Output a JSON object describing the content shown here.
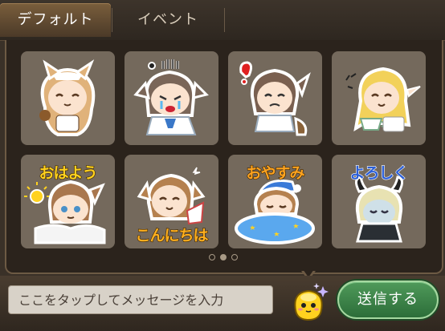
{
  "tabs": [
    {
      "label": "デフォルト",
      "active": true
    },
    {
      "label": "イベント",
      "active": false
    }
  ],
  "stickers": [
    {
      "name": "maid-cat-girl-sticker",
      "text": ""
    },
    {
      "name": "crying-dog-girl-sticker",
      "text": ""
    },
    {
      "name": "exclaim-girl-sticker",
      "text": ""
    },
    {
      "name": "tea-elf-sticker",
      "text": ""
    },
    {
      "name": "ohayou-sticker",
      "text": "おはよう",
      "text_color": "#ffd21f",
      "text_pos": "top"
    },
    {
      "name": "konnichiwa-sticker",
      "text": "こんにちは",
      "text_color": "#ffb01f",
      "text_pos": "bottom"
    },
    {
      "name": "oyasumi-sticker",
      "text": "おやすみ",
      "text_color": "#ffa420",
      "text_pos": "top"
    },
    {
      "name": "yoroshiku-sticker",
      "text": "よろしく",
      "text_color": "#2b5fd8",
      "text_pos": "top"
    }
  ],
  "pagination": {
    "pages": 3,
    "current": 2
  },
  "message": {
    "placeholder": "ここをタップしてメッセージを入力"
  },
  "send_button": {
    "label": "送信する"
  },
  "colors": {
    "panel_bg": "#2b231c",
    "cell_bg": "#74695c",
    "send_green": "#3f8a4a",
    "tab_active": "#6a5034"
  }
}
